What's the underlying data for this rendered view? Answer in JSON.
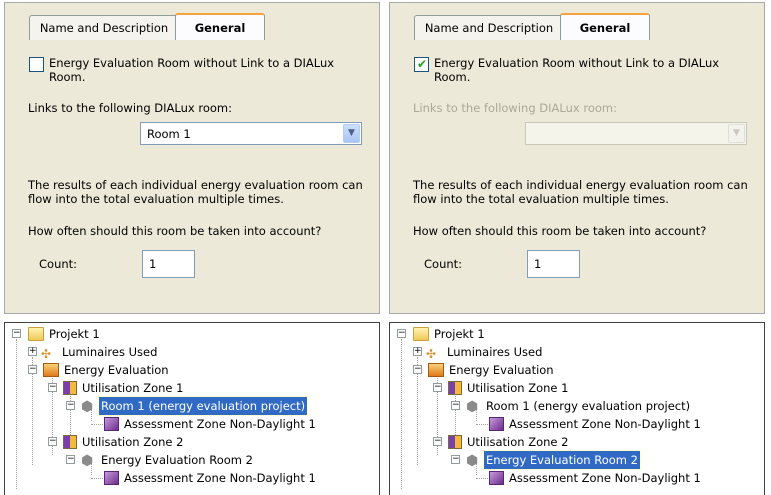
{
  "tabs": {
    "name_desc": "Name and Description",
    "general": "General"
  },
  "left": {
    "checkbox_checked": false,
    "checkbox_label": "Energy Evaluation Room without Link to a DIALux Room.",
    "links_label": "Links to the following DIALux room:",
    "room_value": "Room 1",
    "results_text": "The results of each individual energy evaluation room can flow into the total evaluation multiple times.",
    "how_often": "How often should this room be taken into account?",
    "count_label": "Count:",
    "count_value": "1",
    "tree": {
      "project": "Projekt 1",
      "luminaires": "Luminaires Used",
      "energy_eval": "Energy Evaluation",
      "zone1": "Utilisation Zone 1",
      "room1": "Room 1 (energy evaluation project)",
      "assess1": "Assessment Zone Non-Daylight 1",
      "zone2": "Utilisation Zone 2",
      "room2": "Energy Evaluation Room 2",
      "assess2": "Assessment Zone Non-Daylight 1"
    }
  },
  "right": {
    "checkbox_checked": true,
    "checkbox_label": "Energy Evaluation Room without Link to a DIALux Room.",
    "links_label": "Links to the following DIALux room:",
    "room_value": "",
    "results_text": "The results of each individual energy evaluation room can flow into the total evaluation multiple times.",
    "how_often": "How often should this room be taken into account?",
    "count_label": "Count:",
    "count_value": "1",
    "tree": {
      "project": "Projekt 1",
      "luminaires": "Luminaires Used",
      "energy_eval": "Energy Evaluation",
      "zone1": "Utilisation Zone 1",
      "room1": "Room 1 (energy evaluation project)",
      "assess1": "Assessment Zone Non-Daylight 1",
      "zone2": "Utilisation Zone 2",
      "room2": "Energy Evaluation Room 2",
      "assess2": "Assessment Zone Non-Daylight 1"
    }
  },
  "icons": {
    "checkmark": "✔",
    "dropdown": "▼",
    "collapse": "−",
    "expand": "+"
  }
}
